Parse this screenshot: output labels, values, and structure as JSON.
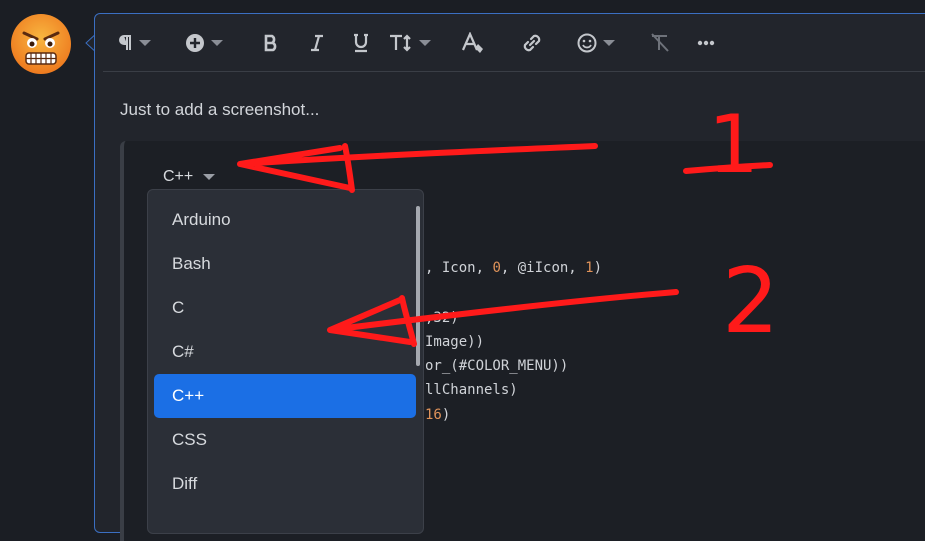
{
  "avatar": {
    "icon": "angry-face-emoji",
    "color": "#f59b2b"
  },
  "toolbar": {
    "items": [
      {
        "name": "paragraph-format",
        "icon": "paragraph-icon",
        "has_caret": true
      },
      {
        "name": "insert",
        "icon": "plus-circle-icon",
        "has_caret": true
      },
      {
        "name": "bold",
        "icon": "bold-icon",
        "has_caret": false
      },
      {
        "name": "italic",
        "icon": "italic-icon",
        "has_caret": false
      },
      {
        "name": "underline",
        "icon": "underline-icon",
        "has_caret": false
      },
      {
        "name": "text-size",
        "icon": "text-size-icon",
        "has_caret": true
      },
      {
        "name": "text-color",
        "icon": "text-color-icon",
        "has_caret": false
      },
      {
        "name": "link",
        "icon": "link-icon",
        "has_caret": false
      },
      {
        "name": "emoji",
        "icon": "smile-icon",
        "has_caret": true
      },
      {
        "name": "clear-format",
        "icon": "clear-format-icon",
        "has_caret": false
      },
      {
        "name": "more",
        "icon": "more-icon",
        "has_caret": false
      }
    ]
  },
  "editor": {
    "intro_text": "Just to add a screenshot...",
    "code_block": {
      "language": "C++",
      "lines": [
        {
          "text": ", Icon, ",
          "num1": "0",
          "mid": ", @iIcon, ",
          "num2": "1",
          "end": ")"
        },
        {
          "text": ",32)"
        },
        {
          "text": "Image))"
        },
        {
          "text": "or_(#COLOR_MENU))"
        },
        {
          "text": "llChannels)"
        },
        {
          "num": "16",
          "end": ")"
        }
      ]
    }
  },
  "language_dropdown": {
    "options": [
      "Arduino",
      "Bash",
      "C",
      "C#",
      "C++",
      "CSS",
      "Diff"
    ],
    "selected": "C++"
  },
  "annotations": {
    "label_1": "1",
    "label_2": "2",
    "color": "#ff1a1a"
  },
  "colors": {
    "accent": "#1b6fe5",
    "editor_border": "#3b6fc2",
    "number": "#e0935a"
  }
}
